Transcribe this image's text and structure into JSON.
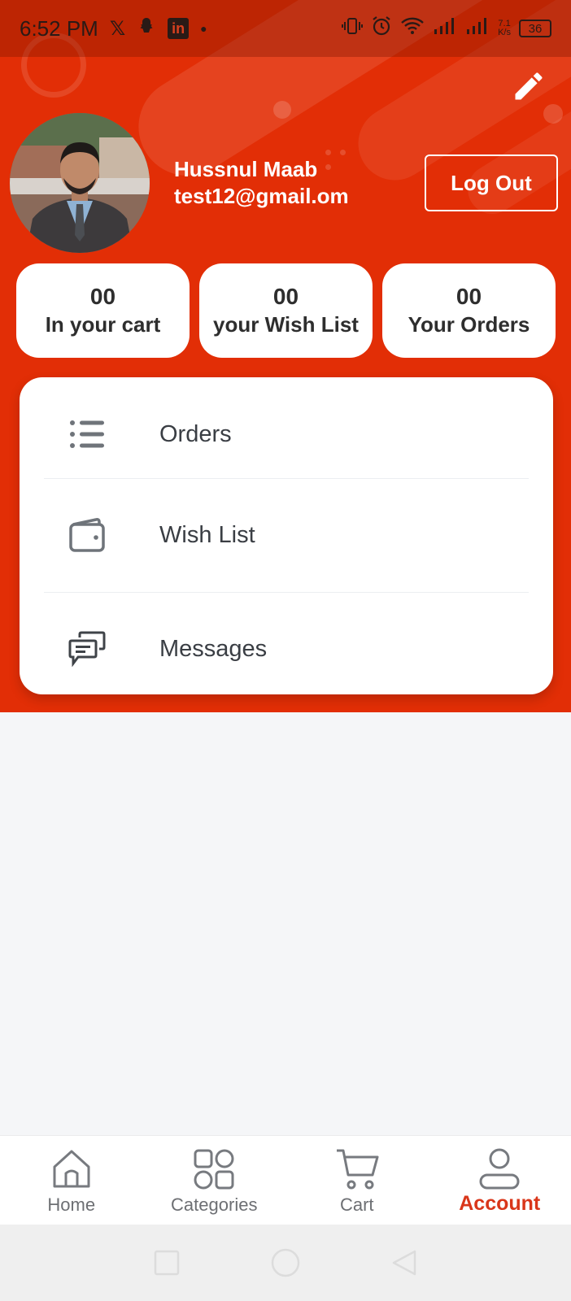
{
  "status_bar": {
    "time": "6:52 PM",
    "network_speed": "7.1",
    "network_unit": "K/s",
    "battery": "36",
    "icons": [
      "x-icon",
      "snapchat-icon",
      "linkedin-icon",
      "vibrate-icon",
      "alarm-icon",
      "wifi-icon",
      "signal-icon",
      "signal-icon"
    ]
  },
  "profile": {
    "name": "Hussnul Maab",
    "email": "test12@gmail.om",
    "logout_label": "Log Out",
    "edit_icon": "pencil-icon"
  },
  "stats": [
    {
      "count": "00",
      "label": "In your cart"
    },
    {
      "count": "00",
      "label": "your Wish List"
    },
    {
      "count": "00",
      "label": "Your Orders"
    }
  ],
  "menu": [
    {
      "label": "Orders",
      "icon": "list-icon"
    },
    {
      "label": "Wish List",
      "icon": "wallet-icon"
    },
    {
      "label": "Messages",
      "icon": "messages-icon"
    }
  ],
  "bottom_nav": [
    {
      "label": "Home",
      "icon": "home-icon",
      "active": false
    },
    {
      "label": "Categories",
      "icon": "categories-icon",
      "active": false
    },
    {
      "label": "Cart",
      "icon": "cart-icon",
      "active": false
    },
    {
      "label": "Account",
      "icon": "account-icon",
      "active": true
    }
  ],
  "colors": {
    "brand": "#e22e06",
    "active_nav": "#d9361a",
    "background": "#f5f6f8"
  }
}
